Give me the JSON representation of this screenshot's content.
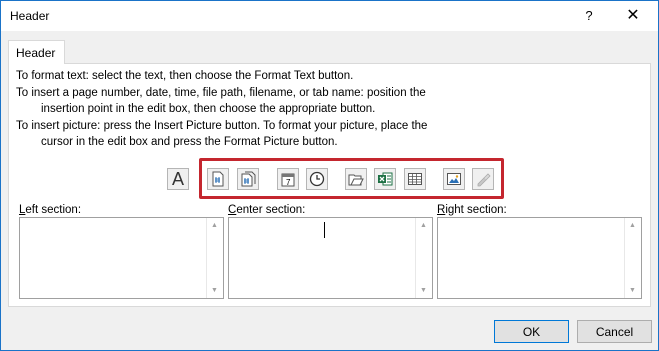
{
  "window": {
    "title": "Header",
    "help_glyph": "?",
    "close_glyph": "✕"
  },
  "tab": {
    "label": "Header"
  },
  "instructions": {
    "line1": "To format text:  select the text, then choose the Format Text button.",
    "line2": "To insert a page number, date, time, file path, filename, or tab name:  position the",
    "line3": "insertion point in the edit box, then choose the appropriate button.",
    "line4": "To insert picture: press the Insert Picture button.  To format your picture, place the",
    "line5": "cursor in the edit box and press the Format Picture button."
  },
  "toolbar": {
    "format_text_glyph": "A",
    "buttons": [
      {
        "name": "insert-page-number-icon"
      },
      {
        "name": "insert-number-of-pages-icon"
      },
      {
        "name": "insert-date-icon",
        "label": "7"
      },
      {
        "name": "insert-time-icon"
      },
      {
        "name": "insert-file-path-icon"
      },
      {
        "name": "insert-file-name-icon"
      },
      {
        "name": "insert-sheet-name-icon"
      },
      {
        "name": "insert-picture-icon"
      },
      {
        "name": "format-picture-icon"
      }
    ],
    "highlight_color": "#c4262e"
  },
  "sections": {
    "left": {
      "prefix": "",
      "accel": "L",
      "rest": "eft section:"
    },
    "center": {
      "prefix": "",
      "accel": "C",
      "rest": "enter section:"
    },
    "right": {
      "prefix": "",
      "accel": "R",
      "rest": "ight section:"
    }
  },
  "buttons": {
    "ok": "OK",
    "cancel": "Cancel"
  },
  "colors": {
    "accent": "#0078d7",
    "dialog_bg": "#f0f0f0"
  }
}
